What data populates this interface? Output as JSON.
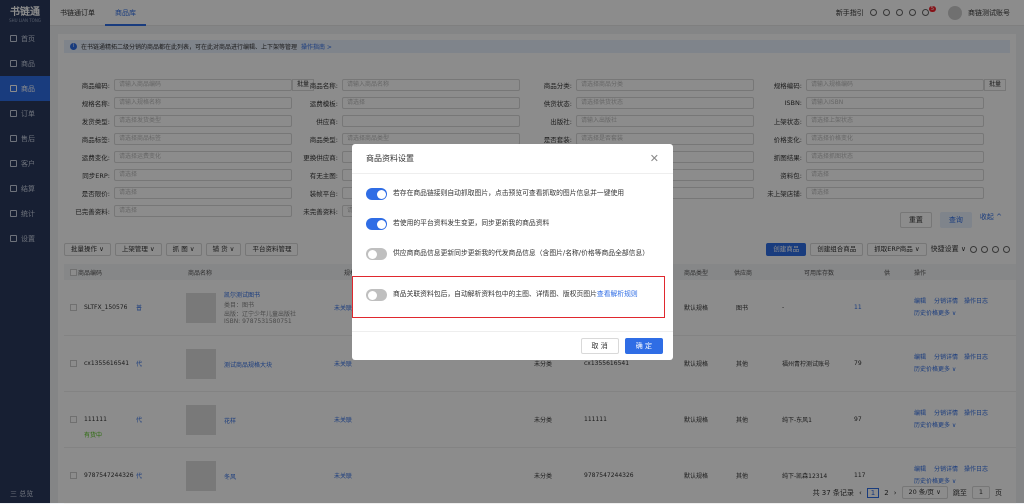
{
  "app": {
    "logo": "书链通",
    "logo_sub": "SHU LIAN TONG"
  },
  "sidebar": {
    "items": [
      {
        "label": "首页",
        "icon": "home-icon"
      },
      {
        "label": "商品",
        "icon": "goods-icon"
      },
      {
        "label": "商品",
        "icon": "goods-icon",
        "active": true
      },
      {
        "label": "订单",
        "icon": "order-icon"
      },
      {
        "label": "售后",
        "icon": "aftersale-icon"
      },
      {
        "label": "客户",
        "icon": "customer-icon"
      },
      {
        "label": "结算",
        "icon": "settle-icon"
      },
      {
        "label": "统计",
        "icon": "stats-icon"
      },
      {
        "label": "设置",
        "icon": "settings-icon"
      }
    ],
    "collapse": "三 总览"
  },
  "tabs": [
    {
      "label": "书链通订单"
    },
    {
      "label": "商品库",
      "active": true
    }
  ],
  "header": {
    "guide": "新手指引",
    "badge": "5",
    "user": "商链测试账号"
  },
  "notice": {
    "text": "在书链通精拓二级分销的商品都在此列表，可在此对商品进行编辑、上下架等管理",
    "link": "操作指南 >"
  },
  "filters": [
    {
      "label": "商品编码:",
      "ph": "请输入商品编码",
      "btn": "批量"
    },
    {
      "label": "商品名称:",
      "ph": "请输入商品名称"
    },
    {
      "label": "商品分类:",
      "ph": "请选择商品分类"
    },
    {
      "label": "规格编码:",
      "ph": "请输入规格编码",
      "btn": "批量"
    },
    {
      "label": "规格名称:",
      "ph": "请输入规格名称"
    },
    {
      "label": "运费模板:",
      "ph": "请选择"
    },
    {
      "label": "供货状态:",
      "ph": "请选择供货状态"
    },
    {
      "label": "ISBN:",
      "ph": "请输入ISBN"
    },
    {
      "label": "发货类型:",
      "ph": "请选择发货类型"
    },
    {
      "label": "供应商:",
      "ph": ""
    },
    {
      "label": "出版社:",
      "ph": "请输入出版社"
    },
    {
      "label": "上架状态:",
      "ph": "请选择上架状态"
    },
    {
      "label": "商品标签:",
      "ph": "请选择商品标签"
    },
    {
      "label": "商品类型:",
      "ph": "请选择商品类型"
    },
    {
      "label": "是否套装:",
      "ph": "请选择是否套装"
    },
    {
      "label": "价格变化:",
      "ph": "请选择价格变化"
    },
    {
      "label": "运费变化:",
      "ph": "请选择运费变化"
    },
    {
      "label": "更换供应商:",
      "ph": ""
    },
    {
      "label": "",
      "ph": ""
    },
    {
      "label": "抓图结果:",
      "ph": "请选择抓图状态"
    },
    {
      "label": "同步ERP:",
      "ph": "请选择"
    },
    {
      "label": "有无主图:",
      "ph": ""
    },
    {
      "label": "",
      "ph": ""
    },
    {
      "label": "资料包:",
      "ph": "请选择"
    },
    {
      "label": "是否限价:",
      "ph": "请选择"
    },
    {
      "label": "装帧平台:",
      "ph": ""
    },
    {
      "label": "",
      "ph": ""
    },
    {
      "label": "未上架店铺:",
      "ph": "请选择"
    },
    {
      "label": "已完善资料:",
      "ph": "请选择"
    },
    {
      "label": "未完善资料:",
      "ph": "请选择"
    }
  ],
  "filter_buttons": {
    "reset": "重置",
    "search": "查询",
    "collapse": "收起 ^"
  },
  "toolbar": {
    "batch": "批量操作 ∨",
    "shelf": "上架管理 ∨",
    "grab": "抓 图 ∨",
    "supply": "铺 货 ∨",
    "platform": "平台资料管理",
    "create": "创建商品",
    "create_combo": "创建组合商品",
    "grab_erp": "抓取ERP商品 ∨",
    "quick": "快捷设置 ∨"
  },
  "table": {
    "headers": [
      "商品编码",
      "商品名称",
      "规格名称",
      "商品类型",
      "供应商",
      "可用库存数",
      "供",
      "操作"
    ],
    "rows": [
      {
        "code": "SLTFX_150576",
        "tag": "普",
        "name": "凯尔测试图书",
        "sub1": "类目：图书",
        "sub2": "出版：辽宁少年儿童出版社",
        "sub3": "ISBN: 9787531580751",
        "status": "未关联",
        "spec": "默认规格",
        "type": "图书",
        "supplier": "-",
        "stock": "11",
        "ops": [
          "编辑",
          "分销详情",
          "操作日志",
          "历史价格",
          "更多 ∨"
        ]
      },
      {
        "code": "cx1355616541",
        "tag": "代",
        "name": "测试商品规格大块",
        "status": "未关联",
        "cat": "未分类",
        "isbn": "cx1355616541",
        "spec": "默认规格",
        "type": "其他",
        "supplier": "福州青柠测试账号",
        "stock": "79",
        "ops": [
          "编辑",
          "分销详情",
          "操作日志",
          "历史价格",
          "更多 ∨"
        ]
      },
      {
        "code": "111111",
        "tag": "代",
        "tag2": "有货中",
        "name": "花样",
        "status": "未关联",
        "cat": "未分类",
        "isbn": "111111",
        "spec": "默认规格",
        "type": "其他",
        "supplier": "纯下-东风1",
        "stock": "97",
        "ops": [
          "编辑",
          "分销详情",
          "操作日志",
          "历史价格",
          "更多 ∨"
        ]
      },
      {
        "code": "9787547244326",
        "tag": "代",
        "name": "冬风",
        "status": "未关联",
        "cat": "未分类",
        "isbn": "9787547244326",
        "spec": "默认规格",
        "type": "其他",
        "supplier": "纯下-凯森12314",
        "stock": "117",
        "ops": [
          "编辑",
          "分销详情",
          "操作日志",
          "历史价格",
          "更多 ∨"
        ]
      }
    ]
  },
  "pager": {
    "total": "共 37 条记录",
    "p1": "1",
    "p2": "2",
    "size": "20 条/页 ∨",
    "goto": "跳至",
    "page": "1",
    "unit": "页"
  },
  "modal": {
    "title": "商品资料设置",
    "options": [
      {
        "text": "若存在商品链接则自动抓取图片，点击预览可查看抓取的图片信息并一键使用",
        "on": true
      },
      {
        "text": "若使用的平台资料发生变更，同步更新我的商品资料",
        "on": true
      },
      {
        "text": "供应商商品信息更新同步更新我的代发商品信息（含图片/名称/价格等商品全部信息）",
        "on": false
      },
      {
        "text": "商品关联资料包后，自动解析资料包中的主图、详情图、版权页图片",
        "link": "查看解析规则",
        "on": false
      }
    ],
    "cancel": "取 消",
    "ok": "确 定"
  }
}
